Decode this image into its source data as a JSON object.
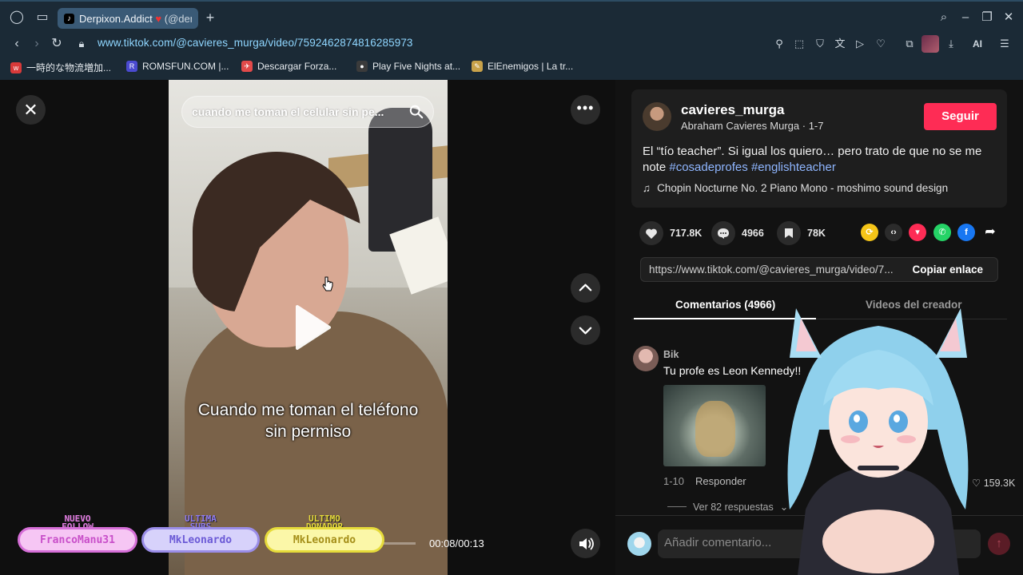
{
  "browser": {
    "tab": {
      "title": "Derpixon.Addict ",
      "title_suffix": "(@der",
      "heart": "♥"
    },
    "url": "www.tiktok.com/@cavieres_murga/video/7592462874816285973",
    "ai_label": "AI",
    "bookmarks": [
      {
        "label": "一時的な物流増加...",
        "icon_color": "#d83a3a"
      },
      {
        "label": "ROMSFUN.COM |...",
        "icon_color": "#4a4ad0"
      },
      {
        "label": "Descargar Forza...",
        "icon_color": "#e24a4a"
      },
      {
        "label": "Play Five Nights at...",
        "icon_color": "#3b3b3b"
      },
      {
        "label": "ElEnemigos | La tr...",
        "icon_color": "#c8a24a"
      }
    ]
  },
  "player": {
    "search_text": "cuando me toman el celular sin pe...",
    "caption_line1": "Cuando me toman el teléfono",
    "caption_line2": "sin permiso",
    "time": "00:08/00:13"
  },
  "overlay_badges": [
    {
      "label_top": "NUEVO",
      "label_bottom": "FOLLOW",
      "name": "FrancoManu31",
      "label_color": "#e07be0",
      "bg": "#f6c6f4",
      "border": "#d66fd8",
      "text_color": "#c84fc9"
    },
    {
      "label_top": "ULTIMA",
      "label_bottom": "SUBS",
      "name": "MkLeonardo",
      "label_color": "#8f7bf0",
      "bg": "#d7d2fb",
      "border": "#9a8de8",
      "text_color": "#6b5ad6"
    },
    {
      "label_top": "ULTIMO",
      "label_bottom": "DONADOR",
      "name": "MkLeonardo",
      "label_color": "#f2e64a",
      "bg": "#fbf7a8",
      "border": "#e6db3a",
      "text_color": "#a58f1a"
    }
  ],
  "info": {
    "username": "cavieres_murga",
    "display_name": "Abraham Cavieres Murga",
    "date": "1-7",
    "follow_label": "Seguir",
    "description": "El “tío teacher”. Si igual los quiero… pero trato de que no se me note ",
    "hashtags": [
      "#cosadeprofes",
      "#englishteacher"
    ],
    "music": "Chopin Nocturne No. 2 Piano Mono - moshimo sound design"
  },
  "stats": {
    "likes": "717.8K",
    "comments": "4966",
    "saves": "78K"
  },
  "share_icons": [
    {
      "name": "repost-icon",
      "color": "#f5c518",
      "glyph": "⟳"
    },
    {
      "name": "embed-icon",
      "color": "#2b2b2b",
      "glyph": "‹›"
    },
    {
      "name": "send-icon",
      "color": "#fe2c55",
      "glyph": "▼"
    },
    {
      "name": "whatsapp-icon",
      "color": "#25d366",
      "glyph": "✆"
    },
    {
      "name": "facebook-icon",
      "color": "#1877f2",
      "glyph": "f"
    }
  ],
  "link": {
    "url": "https://www.tiktok.com/@cavieres_murga/video/7...",
    "copy_label": "Copiar enlace"
  },
  "tabs": {
    "comments": "Comentarios (4966)",
    "creator_videos": "Videos del creador"
  },
  "comment": {
    "user": "Bik",
    "text": "Tu profe es Leon Kennedy!!",
    "date": "1-10",
    "reply_label": "Responder",
    "likes": "159.3K",
    "view_replies": "Ver 82 respuestas"
  },
  "composer": {
    "placeholder": "Añadir comentario..."
  }
}
